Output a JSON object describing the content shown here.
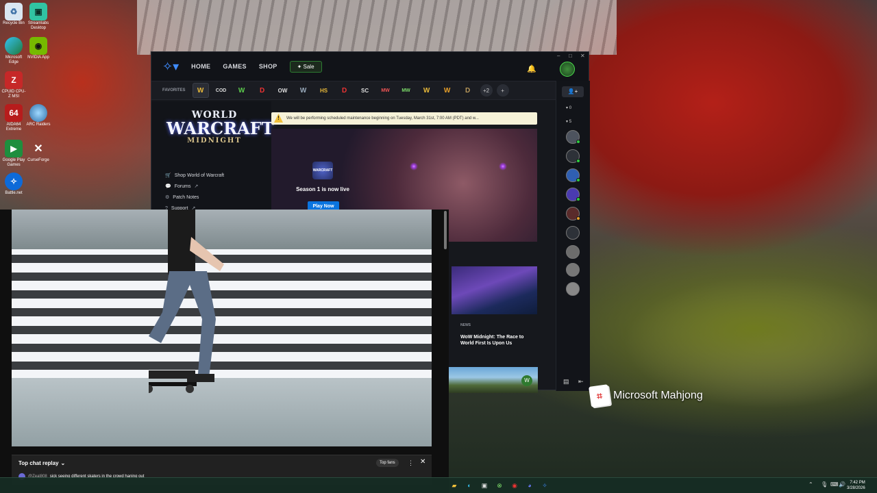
{
  "desktop": {
    "icons": [
      {
        "label": "Recycle Bin",
        "icon": "recycle-bin-icon"
      },
      {
        "label": "Streamlabs Desktop",
        "icon": "streamlabs-icon"
      },
      {
        "label": "Microsoft Edge",
        "icon": "edge-icon"
      },
      {
        "label": "NVIDIA App",
        "icon": "nvidia-icon"
      },
      {
        "label": "CPUID CPU-Z MSI",
        "icon": "cpuz-icon"
      },
      {
        "label": "AIDA64 Extreme",
        "icon": "aida64-icon"
      },
      {
        "label": "ARC Raiders",
        "icon": "arc-raiders-icon"
      },
      {
        "label": "Google Play Games",
        "icon": "google-play-games-icon"
      },
      {
        "label": "CurseForge",
        "icon": "curseforge-icon"
      },
      {
        "label": "Battle.net",
        "icon": "battlenet-icon"
      }
    ],
    "mahjong_label": "Microsoft Mahjong"
  },
  "battlenet": {
    "nav": {
      "home": "HOME",
      "games": "GAMES",
      "shop": "SHOP",
      "sale": "Sale"
    },
    "favorites_label": "FAVORITES",
    "favorites": [
      "W",
      "COD",
      "W",
      "D",
      "OW",
      "W",
      "HS",
      "D",
      "SC",
      "MW",
      "MW",
      "W",
      "W",
      "D"
    ],
    "more_count": "+2",
    "wow_logo": {
      "line1": "WORLD",
      "line2": "WARCRAFT",
      "line3": "MIDNIGHT"
    },
    "side_links": [
      "Shop World of Warcraft",
      "Forums",
      "Patch Notes",
      "Support"
    ],
    "maintenance": "We will be performing scheduled maintenance beginning on Tuesday, March 31st, 7:00 AM (PDT) and w...",
    "hero": {
      "badge": "WARCRAFT",
      "title": "Season 1 is now live",
      "button": "Play Now"
    },
    "news": {
      "tag": "NEWS",
      "title": "WoW Midnight: The Race to World First Is Upon Us"
    },
    "friends": {
      "groups_count": "0",
      "online_count": "5"
    }
  },
  "youtube": {
    "chat_title": "Top chat replay",
    "top_fans": "Top fans",
    "message": {
      "user": "@Zeal808",
      "text": "sick seeing different skaters in the crowd haning out"
    }
  },
  "taskbar": {
    "time": "7:42 PM",
    "date": "3/28/2026"
  }
}
